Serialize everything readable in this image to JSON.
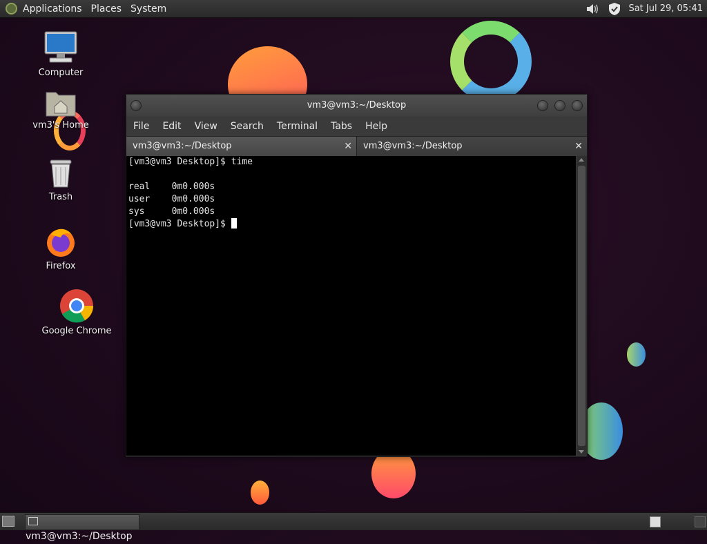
{
  "top_panel": {
    "menus": [
      "Applications",
      "Places",
      "System"
    ],
    "clock": "Sat Jul 29, 05:41",
    "icons": [
      "distributor-logo-icon",
      "volume-icon",
      "shield-icon"
    ]
  },
  "desktop": {
    "icons": [
      {
        "label": "Computer",
        "icon": "computer-icon"
      },
      {
        "label": "vm3's Home",
        "icon": "home-folder-icon"
      },
      {
        "label": "Trash",
        "icon": "trash-icon"
      },
      {
        "label": "Firefox",
        "icon": "firefox-icon"
      },
      {
        "label": "Google Chrome",
        "icon": "chrome-icon"
      }
    ]
  },
  "terminal": {
    "title": "vm3@vm3:~/Desktop",
    "menu": [
      "File",
      "Edit",
      "View",
      "Search",
      "Terminal",
      "Tabs",
      "Help"
    ],
    "tabs": [
      {
        "label": "vm3@vm3:~/Desktop",
        "active": true
      },
      {
        "label": "vm3@vm3:~/Desktop",
        "active": false
      }
    ],
    "lines": [
      "[vm3@vm3 Desktop]$ time",
      "",
      "real\t0m0.000s",
      "user\t0m0.000s",
      "sys\t0m0.000s",
      "[vm3@vm3 Desktop]$ "
    ]
  },
  "bottom_panel": {
    "task_label": "vm3@vm3:~/Desktop"
  },
  "colors": {
    "desktop_bg": "#1d0a1c",
    "panel_bg": "#333333",
    "terminal_bg": "#000000"
  }
}
